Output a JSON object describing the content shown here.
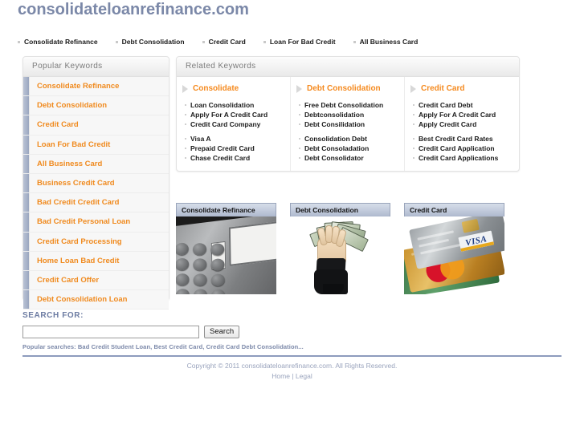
{
  "header": {
    "site_title": "consolidateloanrefinance.com"
  },
  "topnav": {
    "items": [
      {
        "label": "Consolidate Refinance"
      },
      {
        "label": "Debt Consolidation"
      },
      {
        "label": "Credit Card"
      },
      {
        "label": "Loan For Bad Credit"
      },
      {
        "label": "All Business Card"
      }
    ]
  },
  "sidebar": {
    "title": "Popular Keywords",
    "items": [
      {
        "label": "Consolidate Refinance"
      },
      {
        "label": "Debt Consolidation"
      },
      {
        "label": "Credit Card"
      },
      {
        "label": "Loan For Bad Credit"
      },
      {
        "label": "All Business Card"
      },
      {
        "label": "Business Credit Card"
      },
      {
        "label": "Bad Credit Credit Card"
      },
      {
        "label": "Bad Credit Personal Loan"
      },
      {
        "label": "Credit Card Processing"
      },
      {
        "label": "Home Loan Bad Credit"
      },
      {
        "label": "Credit Card Offer"
      },
      {
        "label": "Debt Consolidation Loan"
      }
    ]
  },
  "related": {
    "title": "Related Keywords",
    "columns": [
      {
        "heading": "Consolidate",
        "groups": [
          [
            "Loan Consolidation",
            "Apply For A Credit Card",
            "Credit Card Company"
          ],
          [
            "Visa A",
            "Prepaid Credit Card",
            "Chase Credit Card"
          ]
        ]
      },
      {
        "heading": "Debt Consolidation",
        "groups": [
          [
            "Free Debt Consolidation",
            "Debtconsolidation",
            "Debt Consilidation"
          ],
          [
            "Consolidation Debt",
            "Debt Consoladation",
            "Debt Consolidator"
          ]
        ]
      },
      {
        "heading": "Credit Card",
        "groups": [
          [
            "Credit Card Debt",
            "Apply For A Credit Card",
            "Apply Credit Card"
          ],
          [
            "Best Credit Card Rates",
            "Credit Card Application",
            "Credit Card Applications"
          ]
        ]
      }
    ]
  },
  "thumbnails": [
    {
      "caption": "Consolidate Refinance",
      "image": "calculator-photo"
    },
    {
      "caption": "Debt Consolidation",
      "image": "hand-holding-money-photo"
    },
    {
      "caption": "Credit Card",
      "image": "credit-cards-photo"
    }
  ],
  "search": {
    "label": "SEARCH FOR:",
    "value": "",
    "placeholder": "",
    "button_label": "Search",
    "popular_searches": "Popular searches: Bad Credit Student Loan, Best Credit Card, Credit Card Debt Consolidation..."
  },
  "footer": {
    "copyright": "Copyright © 2011 consolidateloanrefinance.com. All Rights Reserved.",
    "home_label": "Home",
    "separator": " | ",
    "legal_label": "Legal"
  },
  "colors": {
    "title_blue": "#7b88a8",
    "keyword_orange": "#f08a1e",
    "panel_head_gray": "#7c7c7c",
    "search_label_blue": "#6c7ba2",
    "footer_blue": "#9aa4bd",
    "rule_blue": "#8d9bbd",
    "visa_card_blue": "#1b3a80",
    "mastercard_red": "#d7132a",
    "mastercard_orange": "#f09a1a"
  }
}
